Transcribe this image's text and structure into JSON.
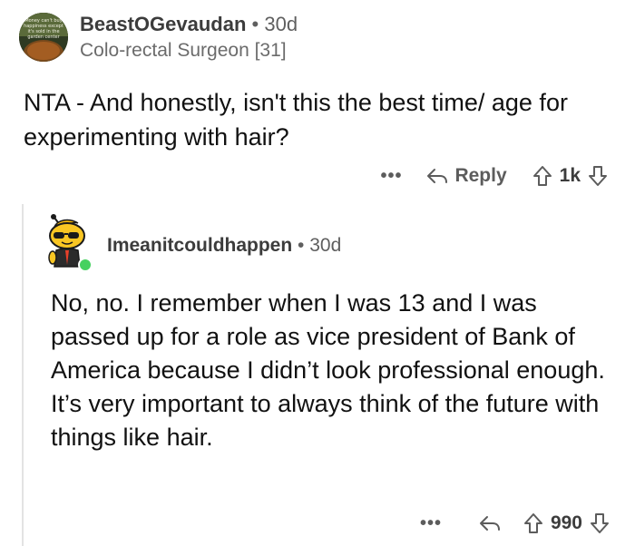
{
  "comment": {
    "username": "BeastOGevaudan",
    "separator": "•",
    "age": "30d",
    "flair": "Colo-rectal Surgeon [31]",
    "avatar_text": "Money can't buy happiness except it's sold in the garden center",
    "body": "NTA - And honestly,  isn't this the best time/ age for experimenting with hair?",
    "more_label": "•••",
    "reply_label": "Reply",
    "score": "1k"
  },
  "reply": {
    "username": "Imeanitcouldhappen",
    "separator": "•",
    "age": "30d",
    "body": "No, no. I remember when I was 13 and I was passed up for a role as vice president of Bank of America because I didn’t look professional enough. It’s very important to always think of the future with things like hair.",
    "more_label": "•••",
    "score": "990"
  },
  "colors": {
    "online": "#46d160",
    "thread_line": "#e3e3e3",
    "muted_text": "#5c5c5c"
  }
}
